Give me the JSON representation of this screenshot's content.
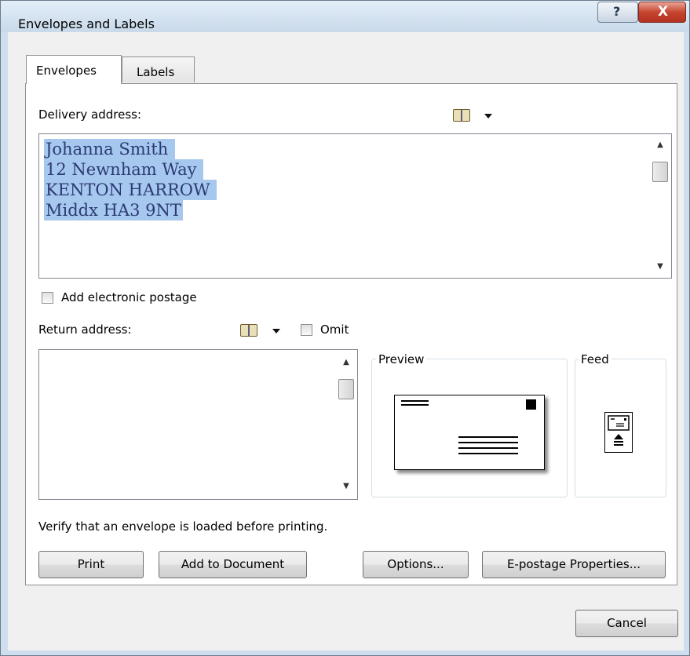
{
  "window": {
    "title": "Envelopes and Labels",
    "help_label": "?",
    "close_label": "X"
  },
  "tabs": [
    {
      "label": "Envelopes",
      "active": true
    },
    {
      "label": "Labels",
      "active": false
    }
  ],
  "delivery": {
    "label": "Delivery address:",
    "address_lines": [
      "Johanna Smith ",
      "12 Newnham Way ",
      "KENTON HARROW ",
      "Middx HA3 9NT"
    ]
  },
  "electronic_postage": {
    "label": "Add electronic postage",
    "checked": false
  },
  "return_address": {
    "label": "Return address:",
    "omit_label": "Omit",
    "omit_checked": false,
    "value": ""
  },
  "preview": {
    "label": "Preview"
  },
  "feed": {
    "label": "Feed"
  },
  "verify_text": "Verify that an envelope is loaded before printing.",
  "buttons": {
    "print": "Print",
    "add_to_document": "Add to Document",
    "options": "Options...",
    "epostage_properties": "E-postage Properties...",
    "cancel": "Cancel"
  },
  "icons": {
    "address_book": "address-book-icon",
    "dropdown": "chevron-down-icon",
    "feed": "envelope-feed-icon"
  }
}
